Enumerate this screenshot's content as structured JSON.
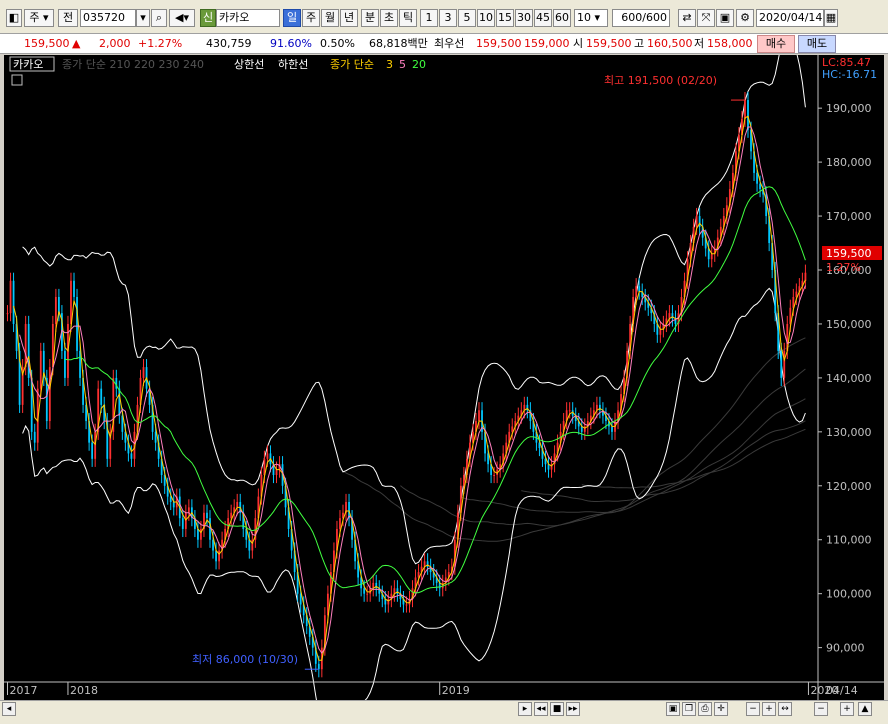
{
  "toolbar": {
    "period_label": "주",
    "all_label": "전",
    "code": "035720",
    "market_badge": "신",
    "stock_name": "카카오",
    "tabs": [
      "일",
      "주",
      "월",
      "년",
      "분",
      "초",
      "틱"
    ],
    "active_tab": "일",
    "numbers": [
      "1",
      "3",
      "5",
      "10",
      "15",
      "30",
      "45",
      "60"
    ],
    "count": "10",
    "range": "600",
    "range_total": "/600",
    "date": "2020/04/14"
  },
  "quote": {
    "price": "159,500",
    "change_arrow": "▲",
    "change": "2,000",
    "change_pct": "+1.27%",
    "volume": "430,759",
    "volume_ratio": "91.60%",
    "turnover": "0.50%",
    "amount": "68,818백만",
    "best_ask_label": "최우선",
    "best_ask": "159,500",
    "best_bid": "159,000",
    "open_label": "시",
    "open": "159,500",
    "high_label": "고",
    "high": "160,500",
    "low_label": "저",
    "low": "158,000",
    "buy_label": "매수",
    "sell_label": "매도"
  },
  "chart_header": {
    "name": "카카오",
    "legend1": "종가 단순 210 220 230 240",
    "legend2": "상한선",
    "legend3": "하한선",
    "legend4": "종가 단순",
    "ma_periods": [
      "3",
      "5",
      "20"
    ],
    "lc": "LC:85.47",
    "hc": "HC:-16.71"
  },
  "annotations": {
    "high": "최고 191,500 (02/20)",
    "low": "최저 86,000 (10/30)",
    "current_price": "159,500",
    "current_pct": "1.27%"
  },
  "colors": {
    "up": "#ff3030",
    "down": "#00c8ff",
    "ma3": "#ffd000",
    "ma5": "#ff80c0",
    "ma20": "#40ff40",
    "band": "#ffffff",
    "axis": "#c0c0c0"
  },
  "chart_data": {
    "type": "line",
    "title": "카카오",
    "y_ticks": [
      90000,
      100000,
      110000,
      120000,
      130000,
      140000,
      150000,
      160000,
      170000,
      180000,
      190000
    ],
    "ylim": [
      84000,
      198000
    ],
    "x_labels": [
      "2017",
      "2018",
      "2019",
      "2020",
      "04/14"
    ],
    "x_label_index": [
      0,
      20,
      143,
      265,
      318
    ],
    "series": [
      {
        "name": "종가",
        "values": [
          152000,
          158000,
          150000,
          145000,
          135000,
          142000,
          150000,
          140000,
          130000,
          128000,
          138000,
          145000,
          140000,
          132000,
          142000,
          150000,
          155000,
          152000,
          145000,
          140000,
          150000,
          158000,
          155000,
          145000,
          140000,
          135000,
          132000,
          128000,
          125000,
          130000,
          138000,
          135000,
          132000,
          125000,
          130000,
          140000,
          138000,
          133000,
          130000,
          128000,
          126000,
          125000,
          130000,
          135000,
          140000,
          142000,
          138000,
          135000,
          130000,
          128000,
          125000,
          122000,
          120000,
          118000,
          117000,
          116000,
          118000,
          114000,
          112000,
          115000,
          116000,
          114000,
          112000,
          110000,
          112000,
          115000,
          114000,
          110000,
          108000,
          106000,
          108000,
          110000,
          112000,
          114000,
          115000,
          116000,
          117000,
          115000,
          112000,
          110000,
          108000,
          110000,
          114000,
          118000,
          122000,
          125000,
          126000,
          124000,
          122000,
          123000,
          124000,
          120000,
          116000,
          112000,
          108000,
          104000,
          100000,
          98000,
          96000,
          94000,
          92000,
          90000,
          87000,
          86000,
          90000,
          96000,
          100000,
          104000,
          108000,
          112000,
          114000,
          115000,
          117000,
          114000,
          110000,
          106000,
          103000,
          101000,
          100000,
          100000,
          101000,
          102000,
          101000,
          100000,
          99000,
          98000,
          99000,
          100000,
          101000,
          100000,
          99000,
          98000,
          98000,
          99000,
          101000,
          103000,
          104000,
          105000,
          106000,
          105000,
          104000,
          103000,
          102000,
          101000,
          102000,
          103000,
          104000,
          105000,
          110000,
          115000,
          120000,
          122000,
          125000,
          128000,
          130000,
          132000,
          134000,
          130000,
          126000,
          124000,
          122000,
          122000,
          123000,
          124000,
          126000,
          128000,
          130000,
          131000,
          132000,
          133000,
          134000,
          135000,
          134000,
          132000,
          130000,
          128000,
          127000,
          125000,
          124000,
          123000,
          124000,
          126000,
          128000,
          130000,
          132000,
          134000,
          134000,
          133000,
          132000,
          131000,
          130000,
          131000,
          132000,
          133000,
          134000,
          135000,
          134000,
          133000,
          132000,
          131000,
          130000,
          132000,
          134000,
          137000,
          140000,
          145000,
          150000,
          155000,
          157000,
          156000,
          155000,
          154000,
          153000,
          152000,
          150000,
          148000,
          149000,
          150000,
          151000,
          152000,
          151000,
          150000,
          152000,
          155000,
          158000,
          162000,
          165000,
          168000,
          170000,
          168000,
          166000,
          164000,
          162000,
          163000,
          164000,
          166000,
          168000,
          170000,
          172000,
          175000,
          178000,
          182000,
          185000,
          188000,
          191500,
          186000,
          182000,
          178000,
          176000,
          175000,
          174000,
          170000,
          165000,
          160000,
          152000,
          145000,
          140000,
          145000,
          150000,
          153000,
          155000,
          156000,
          157000,
          158000,
          159500
        ]
      }
    ]
  }
}
